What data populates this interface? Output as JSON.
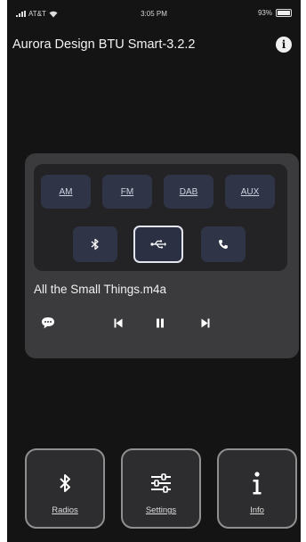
{
  "status_bar": {
    "carrier": "AT&T",
    "time": "3:05 PM",
    "battery": "93%"
  },
  "app": {
    "title": "Aurora Design BTU Smart-3.2.2"
  },
  "sources": [
    {
      "label": "AM"
    },
    {
      "label": "FM"
    },
    {
      "label": "DAB"
    },
    {
      "label": "AUX"
    }
  ],
  "inputs": [
    {
      "icon": "bluetooth-icon",
      "selected": false
    },
    {
      "icon": "usb-icon",
      "selected": true
    },
    {
      "icon": "phone-icon",
      "selected": false
    }
  ],
  "now_playing": {
    "track": "All the Small Things.m4a"
  },
  "playback_icons": [
    "chat-icon",
    "previous-icon",
    "pause-icon",
    "next-icon"
  ],
  "nav": {
    "radios": "Radios",
    "settings": "Settings",
    "info": "Info"
  }
}
